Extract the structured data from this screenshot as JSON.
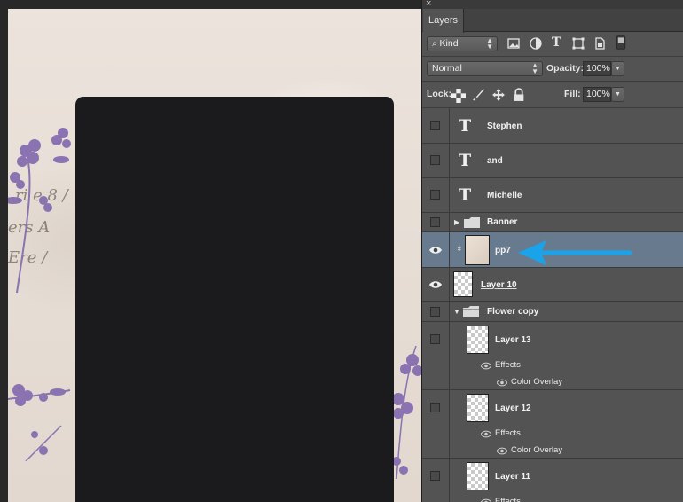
{
  "panel": {
    "close_glyph": "×",
    "tab_label": "Layers",
    "filter": {
      "label": "Kind",
      "icons": [
        "image-filter-icon",
        "adjustment-filter-icon",
        "type-filter-icon",
        "shape-filter-icon",
        "smart-object-filter-icon",
        "filter-toggle-icon"
      ]
    },
    "blend_mode": "Normal",
    "opacity_label": "Opacity:",
    "opacity_value": "100%",
    "lock_label": "Lock:",
    "lock_icons": [
      "lock-transparent-icon",
      "lock-image-icon",
      "lock-position-icon",
      "lock-all-icon"
    ],
    "fill_label": "Fill:",
    "fill_value": "100%"
  },
  "layers": {
    "stephen": "Stephen",
    "and": "and",
    "michelle": "Michelle",
    "banner": "Banner",
    "pp7": "pp7",
    "layer10": "Layer 10",
    "flower_copy": "Flower copy",
    "layer13": "Layer 13",
    "layer12": "Layer 12",
    "layer11": "Layer 11",
    "type_glyph": "T",
    "effects_label": "Effects",
    "color_overlay_label": "Color Overlay"
  },
  "colors": {
    "selected_row": "#687b8e",
    "annotation_arrow": "#1aa3e8",
    "flower": "#8a73b0",
    "photo_frame": "#1b1a1c"
  }
}
